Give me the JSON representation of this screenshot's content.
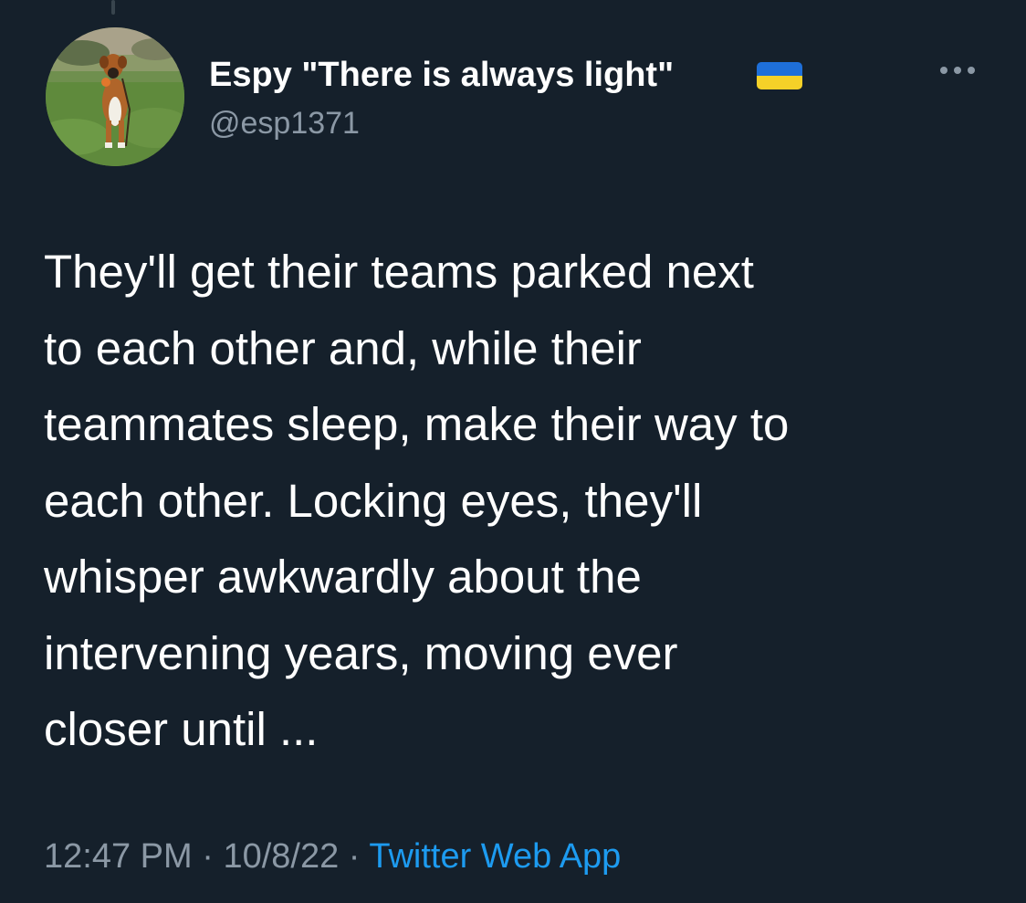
{
  "tweet": {
    "author": {
      "display_name": "Espy \"There is always light\"",
      "handle": "@esp1371",
      "flag_icon": "ukraine-flag-icon",
      "avatar_description": "dog-photo"
    },
    "text_lines": [
      "They'll get their teams parked next",
      "to each other and, while their",
      "teammates sleep, make their way to",
      "each other. Locking eyes, they'll",
      "whisper awkwardly about the",
      "intervening years, moving ever",
      "closer until ..."
    ],
    "time": "12:47 PM",
    "separator": "·",
    "date": "10/8/22",
    "source": "Twitter Web App",
    "more_icon": "more-options-icon"
  },
  "colors": {
    "background": "#15202b",
    "text_primary": "#ffffff",
    "text_secondary": "#8b98a5",
    "link": "#1d9bf0",
    "flag_blue": "#1e6fd9",
    "flag_yellow": "#f5d128"
  }
}
